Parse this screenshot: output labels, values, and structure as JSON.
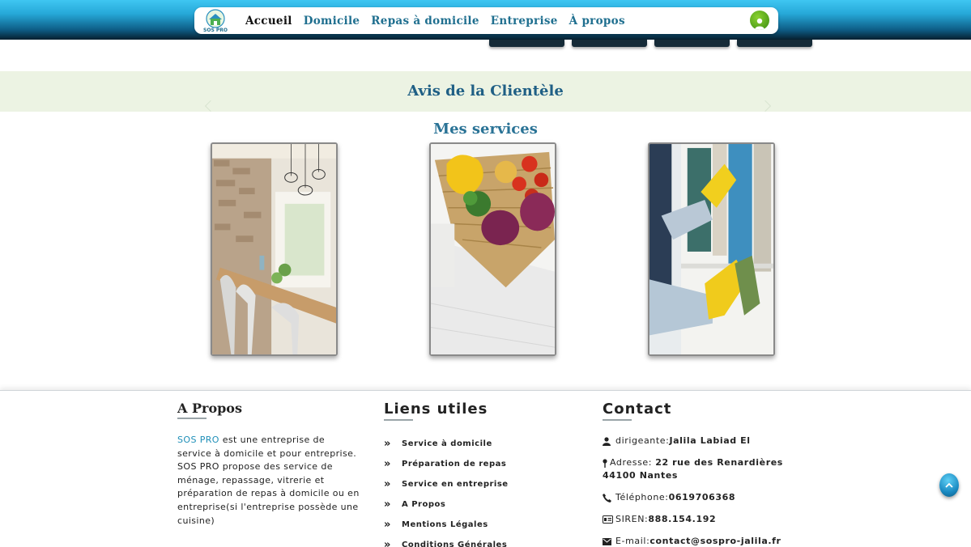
{
  "header": {
    "logo_text": "SOS PRO",
    "nav": [
      {
        "label": "Accueil"
      },
      {
        "label": "Domicile"
      },
      {
        "label": "Repas à domicile"
      },
      {
        "label": "Entreprise"
      },
      {
        "label": "À propos"
      }
    ],
    "user_icon": "user-icon"
  },
  "testimonials": {
    "title": "Avis de la Clientèle"
  },
  "services": {
    "title": "Mes services",
    "cards": [
      {
        "image": "dining-room-photo"
      },
      {
        "image": "vegetable-basket-photo"
      },
      {
        "image": "cleaning-gloves-photo"
      }
    ]
  },
  "footer": {
    "about": {
      "title": "A Propos",
      "brand": "SOS PRO",
      "text": " est une entreprise de service à domicile et pour entreprise. SOS PRO propose des service de ménage, repassage, vitrerie et préparation de repas à domicile ou en entreprise(si l'entreprise possède une cuisine)"
    },
    "links": {
      "title": "Liens utiles",
      "items": [
        "Service à domicile",
        "Préparation de repas",
        "Service en entreprise",
        "A Propos",
        "Mentions Légales",
        "Conditions Générales"
      ]
    },
    "contact": {
      "title": "Contact",
      "manager_label": "dirigeante: ",
      "manager_name": "Jalila Labiad El",
      "address_label": "Adresse: ",
      "address_line1": "22 rue des Renardières",
      "address_line2": "44100 Nantes",
      "phone_label": "Téléphone: ",
      "phone": "0619706368",
      "siren_label": "SIREN: ",
      "siren": "888.154.192",
      "email_label": "E-mail: ",
      "email": "contact@sospro-jalila.fr"
    }
  },
  "colors": {
    "header_gradient_top": "#3fc6f2",
    "header_gradient_bottom": "#07202f",
    "title_blue": "#1f5f85",
    "band_green": "#ecf3e3",
    "link_blue": "#1f6f8f"
  }
}
